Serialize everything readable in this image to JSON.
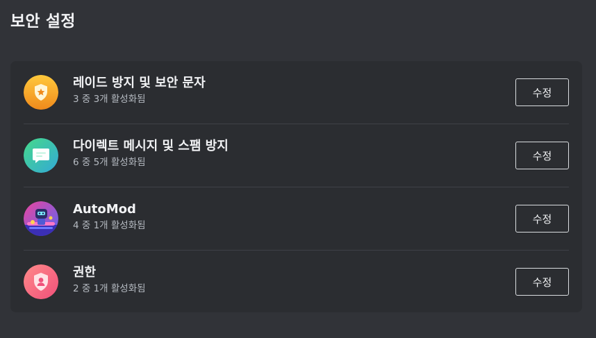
{
  "page": {
    "title": "보안 설정"
  },
  "settings": [
    {
      "title": "레이드 방지 및 보안 문자",
      "status": "3 중 3개 활성화됨",
      "edit_label": "수정",
      "icon": "shield-star-icon",
      "icon_color": "#f9a61a"
    },
    {
      "title": "다이렉트 메시지 및 스팸 방지",
      "status": "6 중 5개 활성화됨",
      "edit_label": "수정",
      "icon": "chat-bubble-icon",
      "icon_color": "#3fcfa4"
    },
    {
      "title": "AutoMod",
      "status": "4 중 1개 활성화됨",
      "edit_label": "수정",
      "icon": "automod-robot-icon",
      "icon_color": "#5865f2"
    },
    {
      "title": "권한",
      "status": "2 중 1개 활성화됨",
      "edit_label": "수정",
      "icon": "shield-user-icon",
      "icon_color": "#f8727f"
    }
  ],
  "colors": {
    "background": "#313338",
    "card": "#2b2d31",
    "text_primary": "#f2f3f5",
    "text_secondary": "#b5bac1",
    "divider": "#3f4147"
  }
}
